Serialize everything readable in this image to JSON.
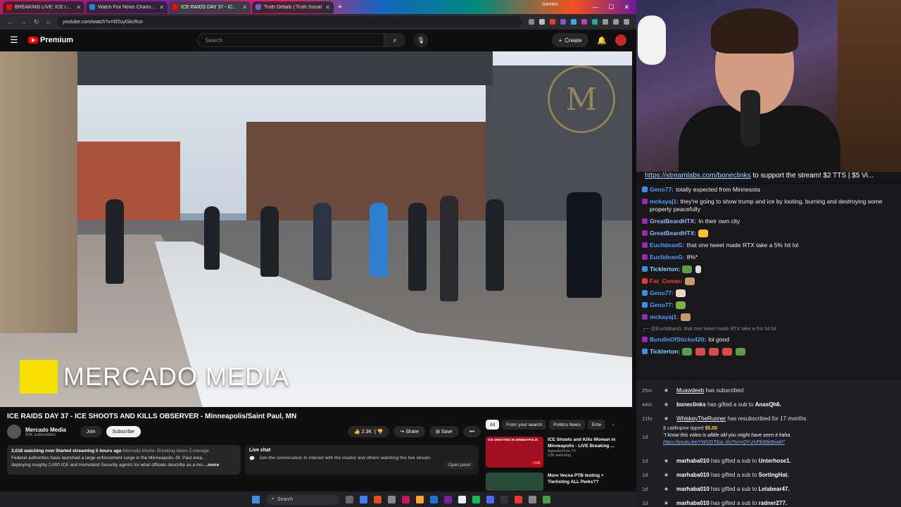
{
  "browser": {
    "tabs": [
      {
        "label": "BREAKING LIVE: ICE related sh...",
        "color": "#ff0000"
      },
      {
        "label": "Watch Fox News Channel O...",
        "color": "#1e88e5"
      },
      {
        "label": "ICE RAIDS DAY 37 - ICE SH...",
        "color": "#ff0000",
        "active": true
      },
      {
        "label": "Truth Details | Truth Social",
        "color": "#5c6bc0"
      }
    ],
    "gemini": "Gemini",
    "url": "youtube.com/watch?v=6f2uyGkcRco"
  },
  "youtube": {
    "logo_text": "Premium",
    "search_placeholder": "Search",
    "create_label": "Create",
    "video_watermark": "MERCADO MEDIA",
    "video_title": "ICE RAIDS DAY 37 - ICE SHOOTS AND KILLS OBSERVER - Minneapolis/Saint Paul, MN",
    "channel_name": "Mercado Media",
    "channel_subs": "91K subscribers",
    "join_label": "Join",
    "subscribe_label": "Subscribe",
    "likes": "2.3K",
    "share_label": "Share",
    "save_label": "Save",
    "desc_stats": "3,018 watching now  Started streaming 5 hours ago",
    "desc_tag": "Mercado Media: Breaking News Coverage",
    "desc_line1": "Federal authorities have launched a large enforcement surge in the Minneapolis–St. Paul area,",
    "desc_line2": "deploying roughly 2,000 ICE and Homeland Security agents for what officials describe as a mo",
    "desc_more": "...more",
    "livechat_title": "Live chat",
    "livechat_text": "Join the conversation to interact with the creator and others watching this live stream.",
    "livechat_open": "Open panel",
    "chips": [
      "All",
      "From your search",
      "Politics News",
      "Ente"
    ],
    "recs": [
      {
        "title": "ICE Shoots and Kills Woman in Minneapolis - LIVE Breaking ...",
        "channel": "Agenda-Free TV",
        "meta": "12K watching",
        "badge": "LIVE",
        "thumb_text": "ICE SHOOTING IN MINNEAPOLIS"
      },
      {
        "title": "More Vecna PTB testing + Tierlisting ALL Perks??",
        "channel": "",
        "meta": "",
        "badge": "",
        "thumb_text": ""
      }
    ],
    "taskbar_search": "Search"
  },
  "stream": {
    "ticker_link": "https://streamlabs.com/boneclinks",
    "ticker_text": " to support the stream! $2 TTS | $5 Vi...",
    "messages": [
      {
        "user": "Geno77:",
        "text": "totally expected from Minnesota",
        "color": "#4f9dff"
      },
      {
        "user": "mckayaj1:",
        "text": "they're going to show trump and ice by looting, burning and destroying some property peacefully",
        "color": "#4f9dff"
      },
      {
        "user": "GreatBeardHTX:",
        "text": "In their own city",
        "color": "#9ab7ff"
      },
      {
        "user": "GreatBeardHTX:",
        "text": "",
        "color": "#9ab7ff"
      },
      {
        "user": "EuclideanG:",
        "text": "that one tweet made RTX take a 5% hit lol",
        "color": "#4f9dff"
      },
      {
        "user": "EuclideanG:",
        "text": "8%*",
        "color": "#4f9dff"
      },
      {
        "user": "Ticklerton:",
        "text": "",
        "color": "#7ed9ff"
      },
      {
        "user": "Fat_Conan:",
        "text": "",
        "color": "#ff3b3b"
      },
      {
        "user": "Geno77:",
        "text": "",
        "color": "#4f9dff"
      },
      {
        "user": "Geno77:",
        "text": "",
        "color": "#4f9dff"
      },
      {
        "user": "mckayaj1:",
        "text": "",
        "color": "#4f9dff"
      }
    ],
    "reply_text": "@EuclideanG: that one tweet made RTX take a 5% hit lol",
    "after": [
      {
        "user": "BundleOfSticks420:",
        "text": "lol good",
        "color": "#4f9dff"
      },
      {
        "user": "Ticklerton:",
        "text": "",
        "color": "#7ed9ff"
      }
    ],
    "events": [
      {
        "time": "25m",
        "name": "Muawdeeb",
        "text": " has subscribed",
        "target": ""
      },
      {
        "time": "44m",
        "name": "boneclinks",
        "text": " has gifted a sub to ",
        "target": "AnasQh6."
      },
      {
        "time": "21hr",
        "name": "WhiskeyTheRunner",
        "text": " has resubscribed for 17 months",
        "target": ""
      }
    ],
    "tip": {
      "time": "1d",
      "name": "caitlinpnw",
      "text": " tipped ",
      "amount": "$5.00",
      "message": "\"I know this video is alittle old you might have seen it haha",
      "link": "https://youtu.be/YWVGT6sL-kU?si=rQY-zVFb06k9riaM\""
    },
    "gifts": [
      {
        "time": "1d",
        "name": "marhaba010",
        "target": "Unterhose1."
      },
      {
        "time": "1d",
        "name": "marhaba010",
        "target": "SortingHat."
      },
      {
        "time": "1d",
        "name": "marhaba010",
        "target": "Lelabear47."
      },
      {
        "time": "1d",
        "name": "marhaba010",
        "target": "radner277."
      }
    ],
    "gift_text": " has gifted a sub to "
  }
}
